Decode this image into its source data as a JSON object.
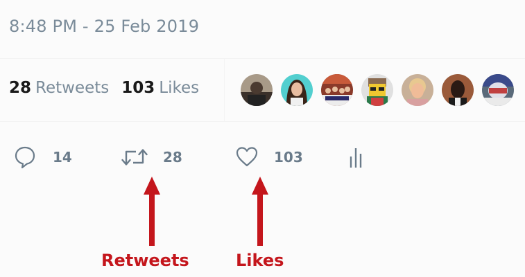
{
  "tweet": {
    "timestamp": "8:48 PM - 25 Feb 2019"
  },
  "stats": {
    "retweets_count": "28",
    "retweets_label": "Retweets",
    "likes_count": "103",
    "likes_label": "Likes"
  },
  "avatars": {
    "count": 7,
    "colors": [
      "#6b5a4a",
      "#4ec9c9",
      "#b04a3a",
      "#e8c840",
      "#e8a870",
      "#2a1a14",
      "#4a7ab8"
    ]
  },
  "actions": {
    "reply_count": "14",
    "retweet_count": "28",
    "like_count": "103",
    "icons": [
      "reply-icon",
      "retweet-icon",
      "heart-icon",
      "analytics-icon"
    ]
  },
  "annotations": {
    "retweets_label": "Retweets",
    "likes_label": "Likes",
    "color": "#c4161c"
  }
}
